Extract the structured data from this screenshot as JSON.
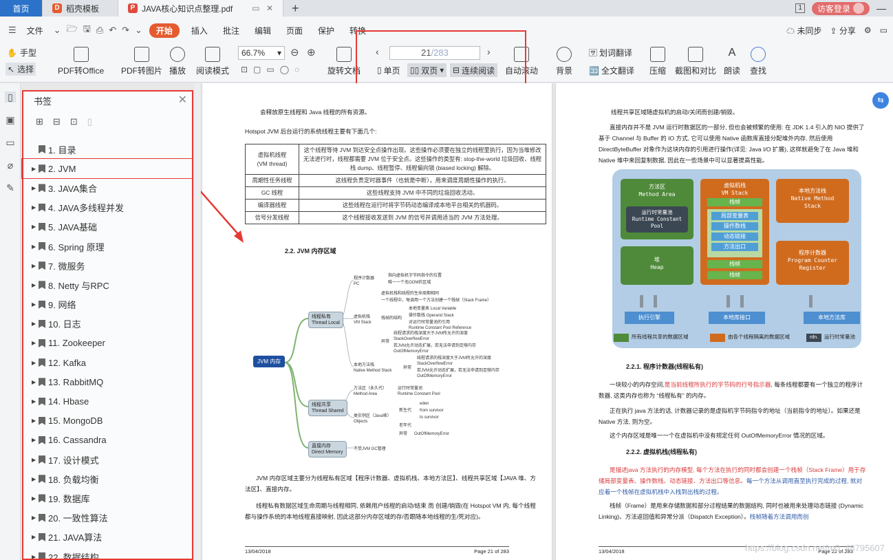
{
  "tabs": {
    "home": "首页",
    "template": "稻壳模板",
    "pdf": "JAVA核心知识点整理.pdf",
    "new_tab": "+"
  },
  "titlebar": {
    "page_badge": "1",
    "login": "访客登录"
  },
  "menu": {
    "file": "文件",
    "start": "开始",
    "items": [
      "插入",
      "批注",
      "编辑",
      "页面",
      "保护",
      "转换"
    ],
    "unsynced": "未同步",
    "share": "分享"
  },
  "ribbon": {
    "hand": "手型",
    "select": "选择",
    "pdf_to_office": "PDF转Office",
    "pdf_to_image": "PDF转图片",
    "play": "播放",
    "read_mode": "阅读模式",
    "zoom": "66.7%",
    "rotate": "旋转文档",
    "page_current": "21",
    "page_total": "/283",
    "single": "单页",
    "double": "双页",
    "continuous": "连续阅读",
    "auto_scroll": "自动滚动",
    "background": "背景",
    "word_translate": "划词翻译",
    "full_translate": "全文翻译",
    "compress": "压缩",
    "screenshot_compare": "截图和对比",
    "read_aloud": "朗读",
    "find": "查找"
  },
  "bookmarks": {
    "title": "书签",
    "items": [
      "1. 目录",
      "2. JVM",
      "3. JAVA集合",
      "4. JAVA多线程并发",
      "5. JAVA基础",
      "6. Spring 原理",
      "7.  微服务",
      "8. Netty 与RPC",
      "9. 网络",
      "10. 日志",
      "11. Zookeeper",
      "12. Kafka",
      "13. RabbitMQ",
      "14. Hbase",
      "15. MongoDB",
      "16. Cassandra",
      "17. 设计模式",
      "18. 负载均衡",
      "19. 数据库",
      "20. 一致性算法",
      "21. JAVA算法",
      "22. 数据结构"
    ]
  },
  "page_left": {
    "line1": "会释放原生线程和 Java 线程的所有资源。",
    "line2": "Hotspot JVM 后台运行的系统线程主要有下面几个:",
    "table": [
      [
        "虚拟机线程\n(VM thread)",
        "这个线程等待 JVM 到达安全点操作出现。这些操作必须要在独立的线程里执行，因为当堆修改无法进行时，线程都需要 JVM 位于安全点。这些操作的类型有: stop-the-world 垃圾回收、线程栈 dump、线程暂停、线程偏向锁 (biased locking) 解除。"
      ],
      [
        "周期性任务线程",
        "这线程负责定时器事件（也就是中断），用来调度周期性操作的执行。"
      ],
      [
        "GC 线程",
        "这些线程支持 JVM 中不同的垃圾回收活动。"
      ],
      [
        "编译器线程",
        "这些线程在运行时将字节码动态编译成本地平台相关的机器码。"
      ],
      [
        "信号分发线程",
        "这个线程接收发送到 JVM 的信号并调用适当的 JVM 方法处理。"
      ]
    ],
    "heading": "2.2. JVM 内存区域",
    "mind": {
      "root": "JVM 内存",
      "local": "线程私有\nThread Local",
      "shared": "线程共享\nThread Shared",
      "direct": "直接内存\nDirect Memory",
      "pc": "程序计数器\nPC",
      "pc_leaf1": "指向虚拟机字节码指令的位置",
      "pc_leaf2": "唯一一个无OOM的区域",
      "vmstack": "虚拟机栈\nVM Stack",
      "vs_leaf1": "虚拟机栈和线程的生命周期相同",
      "vs_leaf2": "一个线程中，每调用一个方法创建一个栈帧（Stack Frame）",
      "frame": "栈帧的结构",
      "fr1": "本地变量表 Local Variable",
      "fr2": "操作数栈 Operand Stack",
      "fr3": "对运行时常量池的引用\nRuntime Constant Pool Reference",
      "ex": "异常",
      "ex1": "线程请求的栈深度大于JVM所允许的深度\nStackOverflowError",
      "ex2": "若JVM允许动态扩展，若无法申请到足够内存\nOutOfMemoryError",
      "native": "本地方法栈\nNative Method Stack",
      "n1": "线程请求的栈深度大于JVM所允许的深度\nStackOverflowError",
      "n2": "若JVM允许动态扩展，若无法申请到足够内存\nOutOfMemoryError",
      "n_ex": "异常",
      "method": "方法区（永久代）\nMethod Area",
      "m1": "运行时常量池\nRuntime Constant Pool",
      "heap": "类实例区（Java堆）\nObjects",
      "young": "新生代",
      "eden": "eden",
      "from": "from survivor",
      "to": "to survivor",
      "old": "老年代",
      "h_ex": "异常",
      "oom": "OutOfMemoryError",
      "d1": "不受JVM GC管理"
    },
    "para1": "JVM 内存区域主要分为线程私有区域【程序计数器、虚拟机栈、本地方法区】、线程共享区域【JAVA 堆、方法区】、直接内存。",
    "para2_red": "线程私有数据区域生命周期与线程相同, 依赖用户线程的启动/结束 而 创建/销毁(在 Hotspot VM 内, 每个线程都与操作系统的本地线程直接映射, 因此这部分内存区域的存/否跟随本地线程的生/死对应)。",
    "footer_date": "13/04/2018",
    "footer_page": "Page 21 of 283"
  },
  "page_right": {
    "line1": "线程共享区域随虚拟机的启动/关闭而创建/销毁。",
    "para1_a": "直接内存并不是 JVM 运行时数据区的一部分, 但也会被频繁的使用: 在 JDK 1.4 引入的 NIO 提供了基于 Channel 与 Buffer 的 IO 方式, 它可以使用 Native 函数库直接分配堆外内存, 然后使用 DirectByteBuffer 对象作为这块内存的引用进行操作(详见: Java I/O 扩展), 这样就避免了在 Java 堆和 Native 堆中来回复制数据, 因此在一些场景中可以显著提高性能。",
    "diagram": {
      "method_area": "方法区\nMethod Area",
      "rcp": "运行时常量池\nRuntime Constant\nPool",
      "heap": "堆\nHeap",
      "vm_stack": "虚拟机栈\nVM Stack",
      "frame": "栈帧",
      "locals": "局部变量表",
      "operand": "操作数栈",
      "dynlink": "动态链接",
      "retaddr": "方法出口",
      "frame2": "栈帧",
      "frame3": "栈帧",
      "native_stack": "本地方法栈\nNative Method\nStack",
      "pc": "程序计数器\nProgram Counter\nRegister",
      "engine": "执行引擎",
      "native_if": "本地库接口",
      "native_lib": "本地方法库",
      "legend1": "所有线程共享的数据区域",
      "legend2": "由各个线程隔离的数据区域",
      "legend3": "运行时常量池",
      "legend3_box": "rdn."
    },
    "h221": "2.2.1. 程序计数器(线程私有)",
    "p221a_1": "一块较小的内存空间,",
    "p221a_red": "是当前线程所执行的字节码的行号指示器",
    "p221a_2": ", 每条线程都要有一个独立的程序计数器, 这类内存也称为 “线程私有” 的内存。",
    "p221b": "正在执行 java 方法的话, 计数器记录的是虚拟机字节码指令的地址（当前指令的地址）。如果还是 Native 方法, 则为空。",
    "p221c": "这个内存区域是唯一一个在虚拟机中没有规定任何 OutOfMemoryError 情况的区域。",
    "h222": "2.2.2. 虚拟机栈(线程私有)",
    "p222a_red": "是描述java 方法执行的内存模型, 每个方法在执行的同时都会创建一个栈帧（Stack Frame）用于存储局部变量表、操作数栈、动态链接、方法出口等信息。",
    "p222a_blue": "每一个方法从调用直至执行完成的过程, 就对应着一个栈帧在虚拟机栈中入栈到出栈的过程。",
    "p222b": "栈帧（Frame）是用来存储数据和部分过程结果的数据结构, 同时也被用来处理动态链接 (Dynamic Linking)、方法返回值和异常分派（Dispatch Exception）。",
    "p222b_blue": "栈帧随着方法调用而创",
    "footer_date": "13/04/2018",
    "footer_page": "Page 22 of 283",
    "watermark": "https://blog.csdn.net/m0_48795607"
  }
}
